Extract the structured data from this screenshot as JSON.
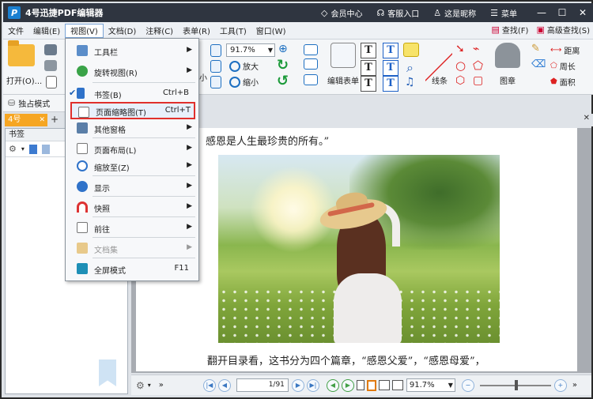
{
  "titlebar": {
    "app_name": "4号迅捷PDF编辑器",
    "logo_letter": "P",
    "links": [
      "会员中心",
      "客服入口",
      "这是昵称",
      "菜单"
    ]
  },
  "menubar": {
    "items": [
      "文件",
      "编辑(E)",
      "视图(V)",
      "文档(D)",
      "注释(C)",
      "表单(R)",
      "工具(T)",
      "窗口(W)"
    ],
    "find_label": "查找(F)",
    "advanced_find_label": "高级查找(S)"
  },
  "ribbon": {
    "open_label": "打开(O)...",
    "zoom_value": "91.7%",
    "zoom_in_label": "放大",
    "zoom_out_label": "缩小",
    "small_label": "小",
    "edit_form_label": "编辑表单",
    "line_label": "线条",
    "stamp_label": "图章",
    "distance_label": "距离",
    "perimeter_label": "周长",
    "area_label": "面积"
  },
  "toolrow": {
    "exclusive_mode_label": "独占模式"
  },
  "tabs": {
    "doc_tab_label": "4号",
    "plus": "+",
    "close": "✕"
  },
  "leftpanel": {
    "title": "书签"
  },
  "document": {
    "line_top": "感恩是人生最珍贵的所有。”",
    "line_bottom": "翻开目录看，这书分为四个篇章，“感恩父爱”，“感恩母爱”，"
  },
  "bottombar": {
    "page_value": "1",
    "page_total": "/91",
    "zoom_value": "91.7%"
  },
  "view_menu": {
    "items": [
      {
        "label": "工具栏",
        "shortcut": "",
        "submenu": true
      },
      {
        "label": "旋转视图(R)",
        "shortcut": "",
        "submenu": true
      },
      {
        "label": "书签(B)",
        "shortcut": "Ctrl+B",
        "submenu": false,
        "checked": true
      },
      {
        "label": "页面缩略图(T)",
        "shortcut": "Ctrl+T",
        "submenu": false,
        "highlighted": true
      },
      {
        "label": "其他窗格",
        "shortcut": "",
        "submenu": true
      },
      {
        "label": "页面布局(L)",
        "shortcut": "",
        "submenu": true
      },
      {
        "label": "缩放至(Z)",
        "shortcut": "",
        "submenu": true
      },
      {
        "label": "显示",
        "shortcut": "",
        "submenu": true
      },
      {
        "label": "快照",
        "shortcut": "",
        "submenu": true
      },
      {
        "label": "前往",
        "shortcut": "",
        "submenu": true
      },
      {
        "label": "文档集",
        "shortcut": "",
        "submenu": true,
        "disabled": true
      },
      {
        "label": "全屏模式",
        "shortcut": "F11",
        "submenu": false
      }
    ]
  },
  "colors": {
    "titlebar": "#2f3540",
    "accent_tab": "#f6a623",
    "highlight_border": "#e0302c"
  }
}
